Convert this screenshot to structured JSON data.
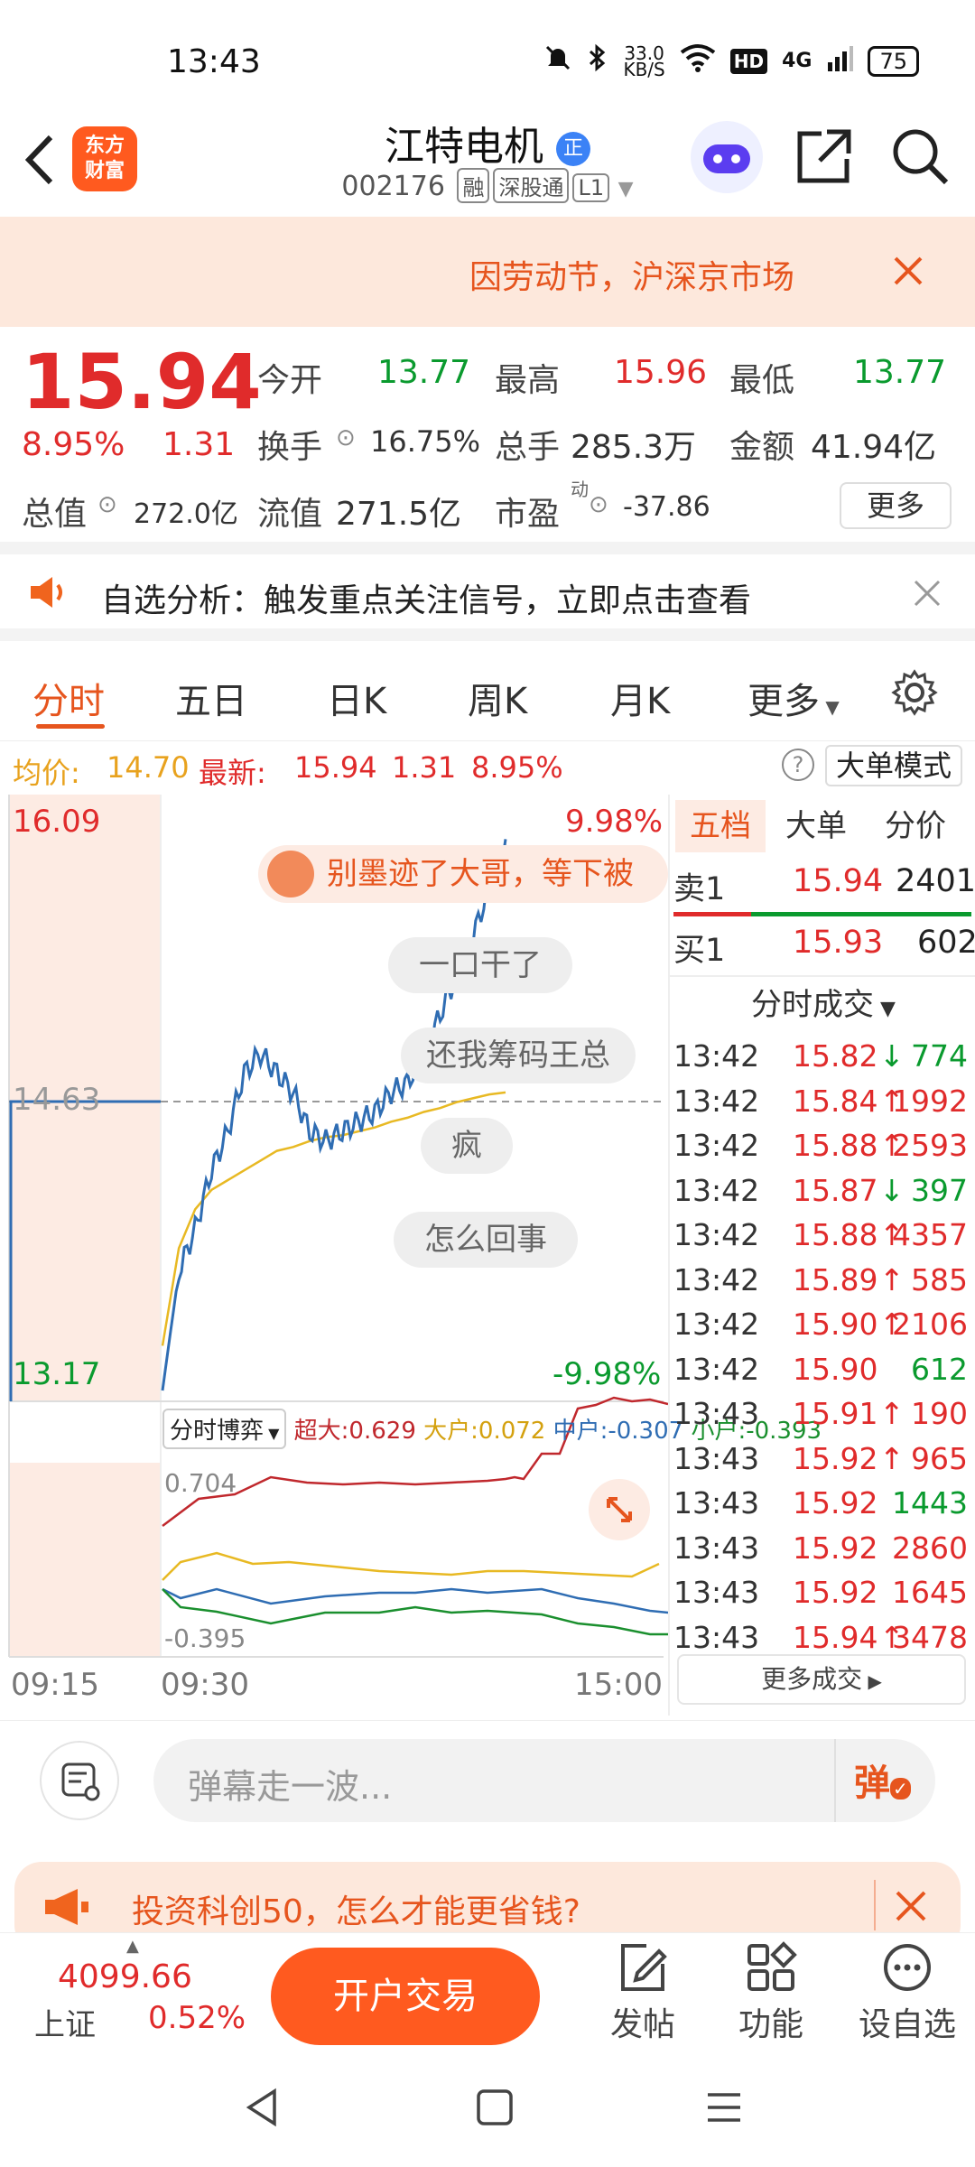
{
  "status_bar": {
    "time": "13:43",
    "speed_value": "33.0",
    "speed_unit": "KB/S",
    "hd": "HD",
    "network": "4G",
    "battery": "75"
  },
  "header": {
    "logo_line1": "东方",
    "logo_line2": "财富",
    "stock_name": "江特电机",
    "name_badge": "正",
    "stock_code": "002176",
    "tag_margin": "融",
    "tag_connect": "深股通",
    "tag_level": "L1"
  },
  "banner": {
    "text": "因劳动节，沪深京市场"
  },
  "quote": {
    "price": "15.94",
    "change_pct": "8.95%",
    "change_amt": "1.31",
    "open_label": "今开",
    "open_value": "13.77",
    "high_label": "最高",
    "high_value": "15.96",
    "low_label": "最低",
    "low_value": "13.77",
    "turnover_label": "换手",
    "turnover_value": "16.75%",
    "volume_label": "总手",
    "volume_value": "285.3万",
    "amount_label": "金额",
    "amount_value": "41.94亿",
    "mktcap_label": "总值",
    "mktcap_value": "272.0亿",
    "float_label": "流值",
    "float_value": "271.5亿",
    "pe_label": "市盈",
    "pe_super": "动",
    "pe_value": "-37.86",
    "more_label": "更多"
  },
  "analysis": {
    "text": "自选分析：触发重点关注信号，立即点击查看"
  },
  "tabs": [
    "分时",
    "五日",
    "日K",
    "周K",
    "月K",
    "更多"
  ],
  "avg_bar": {
    "avg_label": "均价:",
    "avg_value": "14.70",
    "latest_label": "最新:",
    "latest_value": "15.94",
    "latest_change": "1.31",
    "latest_pct": "8.95%",
    "mode_label": "大单模式"
  },
  "chart": {
    "y_max": "16.09",
    "y_mid": "14.63",
    "y_min": "13.17",
    "pct_max": "9.98%",
    "pct_min": "-9.98%",
    "x_labels": [
      "09:15",
      "09:30",
      "15:00"
    ],
    "game_label": "分时博弈",
    "game_super": "超大:0.629",
    "game_big": "大户:0.072",
    "game_mid": "中户:-0.307",
    "game_small": "小户:-0.393",
    "sub_max": "0.704",
    "sub_min": "-0.395",
    "danmaku": [
      "别墨迹了大哥，等下被",
      "一口干了",
      "还我筹码王总",
      "疯",
      "怎么回事"
    ],
    "colors": {
      "price_line": "#2f6db3",
      "avg_line": "#e8b923",
      "super": "#c0282d",
      "big": "#e8b923",
      "mid": "#2f6db3",
      "small": "#1a8f2e"
    }
  },
  "chart_data": {
    "type": "line",
    "title": "",
    "xlabel": "",
    "ylabel": "",
    "x_ticks": [
      "09:15",
      "09:30",
      "15:00"
    ],
    "ylim": [
      13.17,
      16.09
    ],
    "pct_range": [
      "-9.98%",
      "9.98%"
    ],
    "reference_price": 14.63,
    "series": [
      {
        "values": [
          13.17,
          13.78,
          14.0,
          14.3,
          14.5,
          14.8,
          14.9,
          14.8,
          14.7,
          14.5,
          14.45,
          14.5,
          14.55,
          14.6,
          14.7,
          14.75,
          14.9,
          15.1,
          15.3,
          15.5,
          15.75,
          16.0
        ]
      },
      {
        "values": [
          13.4,
          13.9,
          14.1,
          14.2,
          14.25,
          14.3,
          14.35,
          14.4,
          14.42,
          14.45,
          14.47,
          14.48,
          14.5,
          14.52,
          14.55,
          14.57,
          14.6,
          14.62,
          14.65,
          14.67,
          14.69,
          14.7
        ]
      }
    ]
  },
  "order_book": {
    "tabs": [
      "五档",
      "大单",
      "分价"
    ],
    "sell1_label": "卖1",
    "sell1_price": "15.94",
    "sell1_vol": "2401",
    "buy1_label": "买1",
    "buy1_price": "15.93",
    "buy1_vol": "602",
    "trades_title": "分时成交",
    "trades": [
      {
        "time": "13:42",
        "price": "15.82",
        "arrow": "↓",
        "vol": "774",
        "color": "green"
      },
      {
        "time": "13:42",
        "price": "15.84",
        "arrow": "↑",
        "vol": "1992",
        "color": "red"
      },
      {
        "time": "13:42",
        "price": "15.88",
        "arrow": "↑",
        "vol": "2593",
        "color": "red"
      },
      {
        "time": "13:42",
        "price": "15.87",
        "arrow": "↓",
        "vol": "397",
        "color": "green"
      },
      {
        "time": "13:42",
        "price": "15.88",
        "arrow": "↑",
        "vol": "4357",
        "color": "red"
      },
      {
        "time": "13:42",
        "price": "15.89",
        "arrow": "↑",
        "vol": "585",
        "color": "red"
      },
      {
        "time": "13:42",
        "price": "15.90",
        "arrow": "↑",
        "vol": "2106",
        "color": "red"
      },
      {
        "time": "13:42",
        "price": "15.90",
        "arrow": "",
        "vol": "612",
        "color": "green"
      },
      {
        "time": "13:43",
        "price": "15.91",
        "arrow": "↑",
        "vol": "190",
        "color": "red"
      },
      {
        "time": "13:43",
        "price": "15.92",
        "arrow": "↑",
        "vol": "965",
        "color": "red"
      },
      {
        "time": "13:43",
        "price": "15.92",
        "arrow": "",
        "vol": "1443",
        "color": "green"
      },
      {
        "time": "13:43",
        "price": "15.92",
        "arrow": "",
        "vol": "2860",
        "color": "red"
      },
      {
        "time": "13:43",
        "price": "15.92",
        "arrow": "",
        "vol": "1645",
        "color": "red"
      },
      {
        "time": "13:43",
        "price": "15.94",
        "arrow": "↑",
        "vol": "3478",
        "color": "red"
      }
    ],
    "more_trades": "更多成交"
  },
  "comment_bar": {
    "placeholder": "弹幕走一波...",
    "danmaku_button": "弹"
  },
  "promo": {
    "text": "投资科创50，怎么才能更省钱?"
  },
  "bottom_nav": {
    "index_value": "4099.66",
    "index_name": "上证",
    "index_pct": "0.52%",
    "trade_button": "开户交易",
    "post": "发帖",
    "function": "功能",
    "favorite": "设自选"
  }
}
